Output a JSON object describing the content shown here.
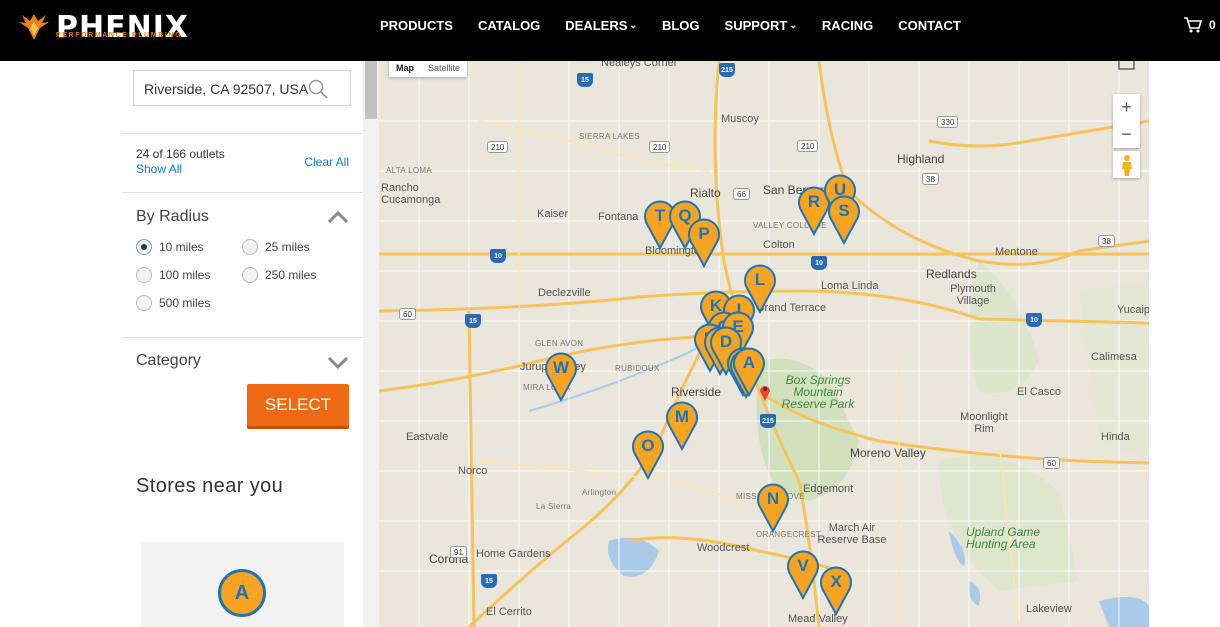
{
  "header": {
    "logo_text": "PHENIX",
    "logo_subtitle": "PERFORMANCE PLUMBING",
    "nav": [
      {
        "label": "PRODUCTS"
      },
      {
        "label": "CATALOG"
      },
      {
        "label": "DEALERS"
      },
      {
        "label": "BLOG"
      },
      {
        "label": "SUPPORT"
      },
      {
        "label": "RACING"
      },
      {
        "label": "CONTACT"
      }
    ],
    "cart_count": "0"
  },
  "sidebar": {
    "search_value": "Riverside, CA 92507, USA",
    "outlets_text": "24 of 166 outlets",
    "show_all": "Show All",
    "clear_all": "Clear All",
    "radius_title": "By Radius",
    "radius_options": [
      "10 miles",
      "25 miles",
      "100 miles",
      "250 miles",
      "500 miles"
    ],
    "radius_selected": "10 miles",
    "category_title": "Category",
    "select_label": "SELECT",
    "stores_title": "Stores near you",
    "first_store_letter": "A"
  },
  "map": {
    "map_type_map": "Map",
    "map_type_satellite": "Satellite",
    "zoom_in": "+",
    "zoom_out": "−",
    "places": [
      "Nealeys Corner",
      "Muscoy",
      "Highland",
      "Rialto",
      "San Bernardino",
      "Rancho Cucamonga",
      "Fontana",
      "Kaiser",
      "Bloomington",
      "Colton",
      "Mentone",
      "Redlands",
      "Loma Linda",
      "Plymouth Village",
      "Yucaipa",
      "Declezville",
      "Grand Terrace",
      "Jurupa Valley",
      "Calimesa",
      "Riverside",
      "Box Springs Mountain Reserve Park",
      "El Casco",
      "Moonlight Rim",
      "Eastvale",
      "Hinda",
      "Moreno Valley",
      "Norco",
      "Edgemont",
      "Arlington",
      "La Sierra",
      "Woodcrest",
      "March Air Reserve Base",
      "Upland Game Hunting Area",
      "Corona",
      "Home Gardens",
      "El Cerrito",
      "Mead Valley",
      "Lakeview",
      "SIERRA LAKES",
      "ALTA LOMA",
      "VALLEY COLLEGE",
      "GLEN AVON",
      "MIRA LOMA",
      "RUBIDOUX",
      "MISSION GROVE",
      "ORANGECREST"
    ],
    "markers": [
      "T",
      "Q",
      "P",
      "R",
      "U",
      "S",
      "L",
      "K",
      "J",
      "G",
      "E",
      "H",
      "F",
      "D",
      "C",
      "B",
      "A",
      "W",
      "M",
      "O",
      "N",
      "V",
      "X",
      "I"
    ]
  }
}
